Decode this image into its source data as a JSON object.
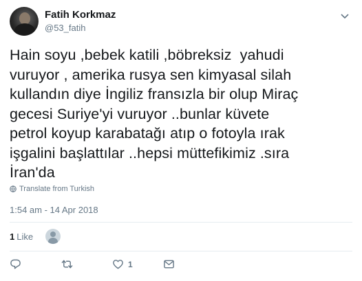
{
  "author": {
    "display_name": "Fatih Korkmaz",
    "handle": "@53_fatih"
  },
  "tweet": {
    "lines": [
      "Hain soyu ,bebek katili ,böbreksiz  yahudi",
      "vuruyor , amerika rusya sen kimyasal silah",
      "kullandın diye İngiliz fransızla bir olup Miraç",
      "gecesi Suriye'yi vuruyor ..bunlar küvete",
      "petrol koyup karabatağı atıp o fotoyla ırak",
      "işgalini başlattılar ..hepsi müttefikimiz .sıra",
      "İran'da"
    ],
    "translate_label": "Translate from Turkish",
    "timestamp": "1:54 am - 14 Apr 2018"
  },
  "stats": {
    "like_count": "1",
    "like_label": "Like"
  },
  "actions": {
    "reply_count": "",
    "retweet_count": "",
    "like_count": "1",
    "dm_count": ""
  },
  "icons": [
    "avatar",
    "chevron-down-icon",
    "globe-icon",
    "reply-icon",
    "retweet-icon",
    "heart-icon",
    "envelope-icon"
  ],
  "colors": {
    "text": "#14171a",
    "secondary": "#657786",
    "divider": "#e6ecf0"
  }
}
